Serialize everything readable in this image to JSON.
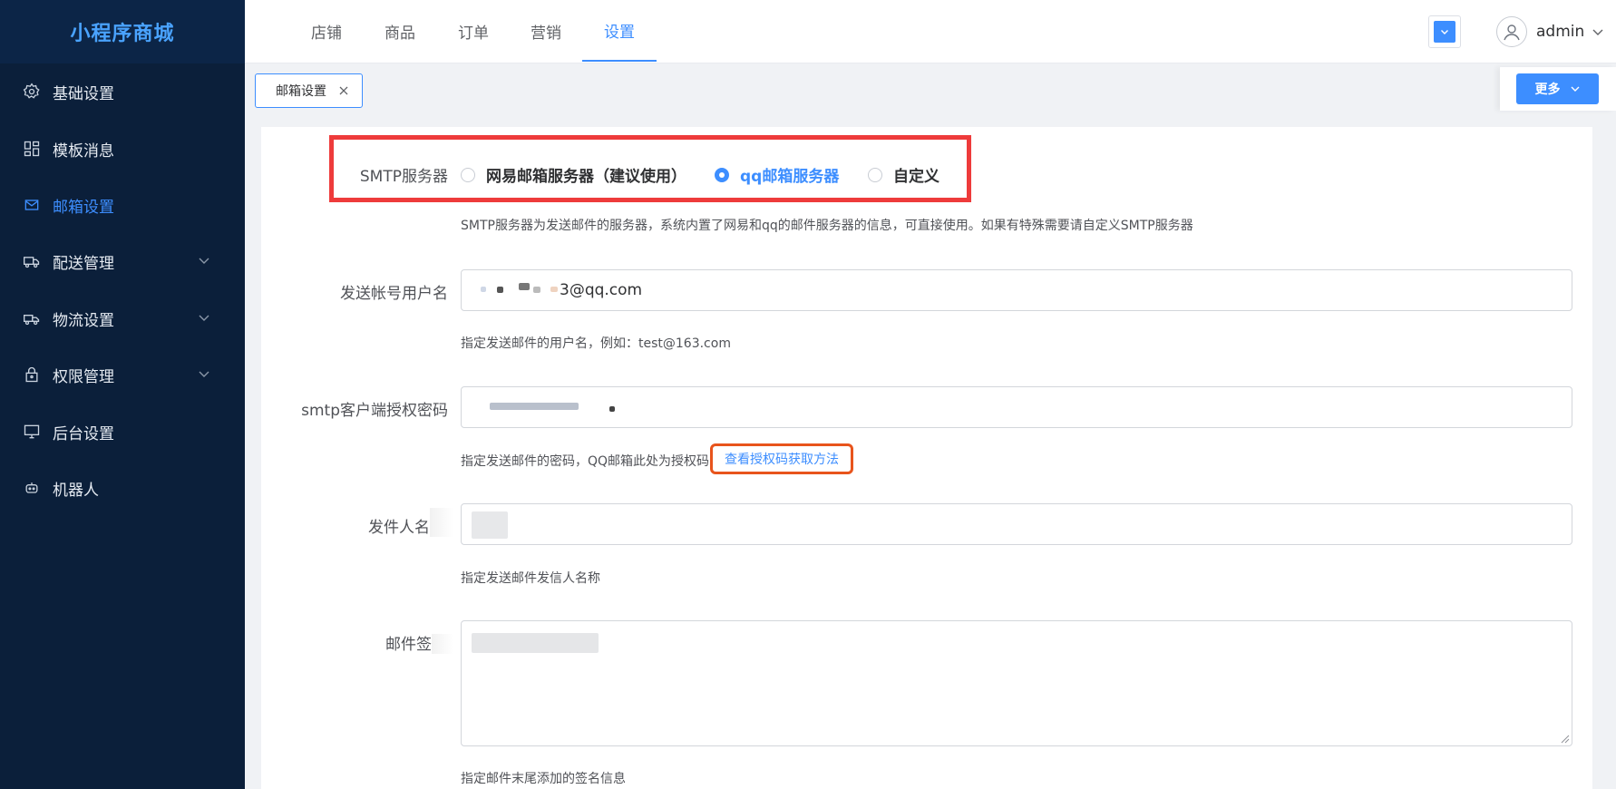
{
  "app": {
    "logo_text": "小程序商城"
  },
  "sidebar": {
    "items": [
      {
        "label": "基础设置",
        "icon": "gear-icon"
      },
      {
        "label": "模板消息",
        "icon": "grid-icon"
      },
      {
        "label": "邮箱设置",
        "icon": "mail-icon",
        "active": true
      },
      {
        "label": "配送管理",
        "icon": "truck-icon",
        "expandable": true
      },
      {
        "label": "物流设置",
        "icon": "delivery-truck-icon",
        "expandable": true
      },
      {
        "label": "权限管理",
        "icon": "lock-icon",
        "expandable": true
      },
      {
        "label": "后台设置",
        "icon": "monitor-icon"
      },
      {
        "label": "机器人",
        "icon": "robot-icon"
      }
    ]
  },
  "header": {
    "tabs": [
      {
        "label": "店铺"
      },
      {
        "label": "商品"
      },
      {
        "label": "订单"
      },
      {
        "label": "营销"
      },
      {
        "label": "设置",
        "active": true
      }
    ],
    "user": {
      "name": "admin"
    }
  },
  "tabstrip": {
    "open_tab": "邮箱设置",
    "more_label": "更多"
  },
  "form": {
    "smtp": {
      "label": "SMTP服务器",
      "options": [
        {
          "label": "网易邮箱服务器（建议使用）",
          "checked": false
        },
        {
          "label": "qq邮箱服务器",
          "checked": true
        },
        {
          "label": "自定义",
          "checked": false
        }
      ],
      "hint": "SMTP服务器为发送邮件的服务器，系统内置了网易和qq的邮件服务器的信息，可直接使用。如果有特殊需要请自定义SMTP服务器"
    },
    "username": {
      "label": "发送帐号用户名",
      "value": "3@qq.com",
      "hint": "指定发送邮件的用户名，例如：test@163.com"
    },
    "password": {
      "label": "smtp客户端授权密码",
      "hint": "指定发送邮件的密码，QQ邮箱此处为授权码",
      "link": "查看授权码获取方法"
    },
    "sender": {
      "label": "发件人名",
      "hint": "指定发送邮件发信人名称"
    },
    "signature": {
      "label": "邮件签",
      "hint": "指定邮件末尾添加的签名信息"
    }
  },
  "colors": {
    "accent": "#3d8eff",
    "sidebar_bg": "#0b1f3a",
    "highlight_red": "#ee3b3b",
    "highlight_orange": "#e8541c"
  }
}
